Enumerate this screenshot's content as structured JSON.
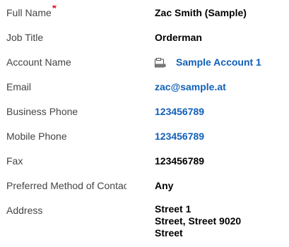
{
  "fields": [
    {
      "label": "Full Name",
      "required_mark": "*",
      "value": "Zac Smith (Sample)"
    },
    {
      "label": "Job Title",
      "value": "Orderman"
    },
    {
      "label": "Account Name",
      "value": "Sample Account 1",
      "icon": "account-icon"
    },
    {
      "label": "Email",
      "value": "zac@sample.at"
    },
    {
      "label": "Business Phone",
      "value": "123456789"
    },
    {
      "label": "Mobile Phone",
      "value": "123456789"
    },
    {
      "label": "Fax",
      "value": "123456789"
    },
    {
      "label": "Preferred Method of Contact",
      "value": "Any"
    },
    {
      "label": "Address",
      "value_lines": [
        "Street 1",
        "Street, Street 9020",
        "Street"
      ]
    }
  ],
  "colors": {
    "link": "#1160b7",
    "required": "#e3001b",
    "label": "#444444"
  }
}
